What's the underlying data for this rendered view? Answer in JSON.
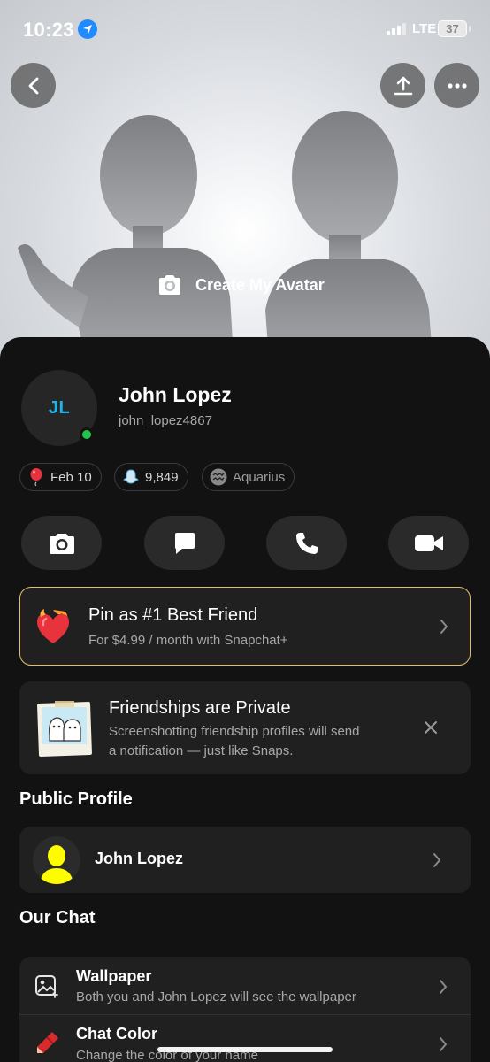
{
  "status_bar": {
    "time": "10:23",
    "network": "LTE",
    "battery": "37"
  },
  "header": {
    "create_avatar_label": "Create My Avatar"
  },
  "profile": {
    "initials": "JL",
    "display_name": "John Lopez",
    "username": "john_lopez4867",
    "chips": {
      "birthday": "Feb 10",
      "score": "9,849",
      "zodiac": "Aquarius"
    }
  },
  "pin_card": {
    "title": "Pin as #1 Best Friend",
    "subtitle": "For $4.99 / month with Snapchat+"
  },
  "privacy_card": {
    "title": "Friendships are Private",
    "subtitle_line1": "Screenshotting friendship profiles will send",
    "subtitle_line2": "a notification — just like Snaps."
  },
  "public_profile": {
    "section_title": "Public Profile",
    "name": "John Lopez"
  },
  "our_chat": {
    "section_title": "Our Chat",
    "wallpaper": {
      "title": "Wallpaper",
      "subtitle": "Both you and John Lopez will see the wallpaper"
    },
    "chat_color": {
      "title": "Chat Color",
      "subtitle": "Change the color of your name"
    }
  },
  "colors": {
    "accent_gold": "#e2bd6a",
    "initials_blue": "#1fb4e8",
    "online_green": "#21c64a"
  }
}
